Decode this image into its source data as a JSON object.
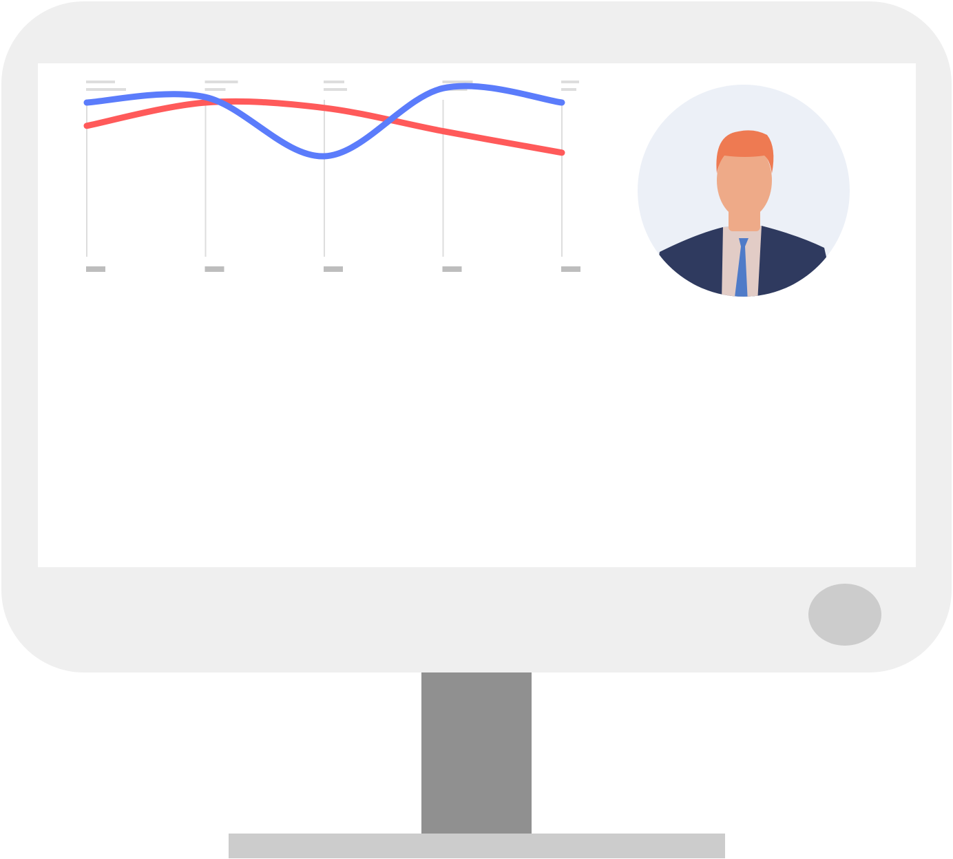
{
  "colors": {
    "monitor_frame": "#efefef",
    "screen": "#ffffff",
    "stand_neck": "#909090",
    "stand_base": "#cccccc",
    "power_button": "#cccccc",
    "series_blue": "#5b7cfb",
    "series_red": "#ff5a5a",
    "gridline": "#dddddd",
    "placeholder_text": "#bdbdbd",
    "avatar_background": "#ecf0f7",
    "hair": "#ee7a52",
    "skin": "#eeaa88",
    "suit": "#2f3a5f",
    "shirt": "#e2ccc6",
    "tie": "#4f7bc8"
  },
  "icons": {
    "avatar": "businessman-avatar-icon",
    "power": "power-button-icon"
  },
  "chart_data": {
    "type": "line",
    "x": [
      1,
      2,
      3,
      4,
      5
    ],
    "title": "",
    "xlabel": "",
    "ylabel": "",
    "tick_labels": [],
    "ylim": [
      0,
      1
    ],
    "grid": true,
    "series": [
      {
        "values": [
          0.85,
          0.88,
          0.55,
          0.93,
          0.85
        ]
      },
      {
        "values": [
          0.72,
          0.85,
          0.82,
          0.69,
          0.57
        ]
      }
    ]
  }
}
